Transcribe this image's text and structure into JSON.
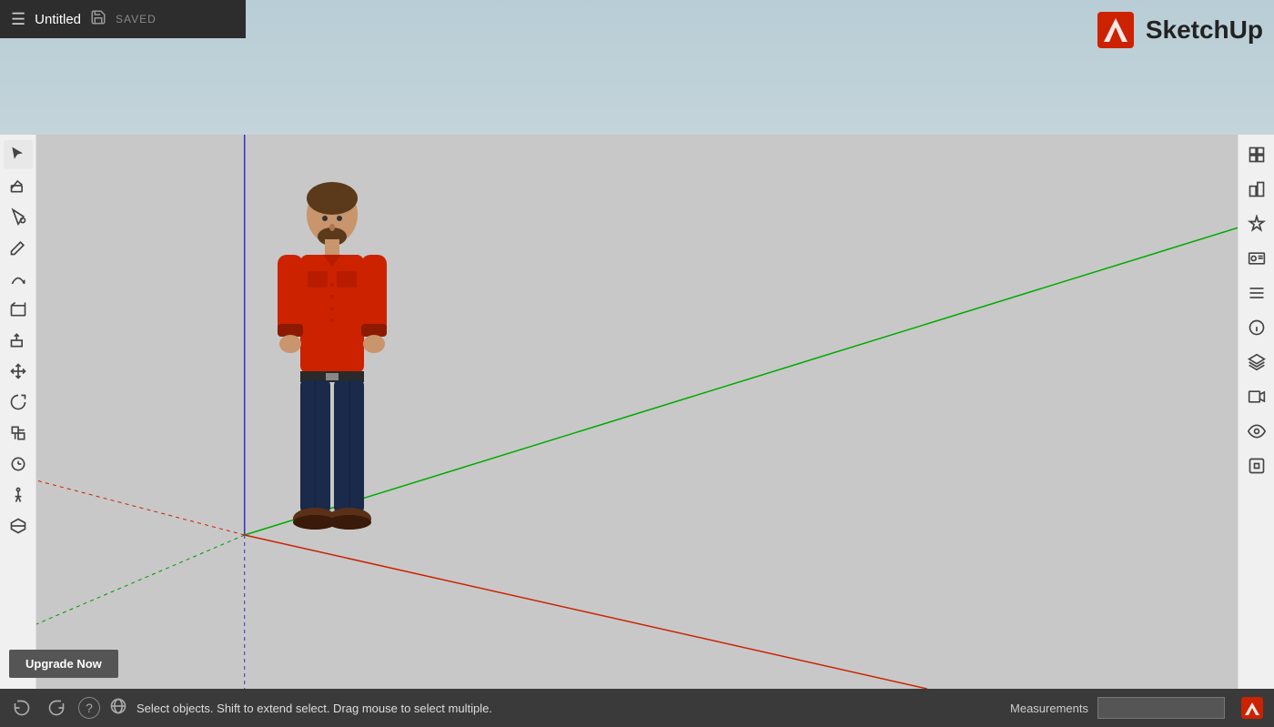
{
  "titlebar": {
    "title": "Untitled",
    "saved_label": "SAVED"
  },
  "logo": {
    "text": "SketchUp"
  },
  "bottom_bar": {
    "status_text": "Select objects. Shift to extend select. Drag mouse to select multiple.",
    "measurements_label": "Measurements",
    "measurements_value": ""
  },
  "upgrade_button": {
    "label": "Upgrade Now"
  },
  "left_tools": [
    {
      "name": "select",
      "icon": "cursor"
    },
    {
      "name": "eraser",
      "icon": "eraser"
    },
    {
      "name": "paint-bucket",
      "icon": "paint"
    },
    {
      "name": "pencil",
      "icon": "pencil"
    },
    {
      "name": "arc",
      "icon": "arc"
    },
    {
      "name": "shape",
      "icon": "shape"
    },
    {
      "name": "push-pull",
      "icon": "pushpull"
    },
    {
      "name": "move",
      "icon": "move"
    },
    {
      "name": "rotate",
      "icon": "rotate"
    },
    {
      "name": "scale",
      "icon": "scale"
    },
    {
      "name": "tape-measure",
      "icon": "tape"
    },
    {
      "name": "walk",
      "icon": "walk"
    },
    {
      "name": "section-plane",
      "icon": "section"
    }
  ],
  "right_tools": [
    {
      "name": "materials",
      "icon": "materials"
    },
    {
      "name": "components",
      "icon": "components"
    },
    {
      "name": "styles",
      "icon": "styles"
    },
    {
      "name": "scenes",
      "icon": "scenes"
    },
    {
      "name": "outliner",
      "icon": "outliner"
    },
    {
      "name": "entity-info",
      "icon": "entity"
    },
    {
      "name": "layers",
      "icon": "layers"
    },
    {
      "name": "video",
      "icon": "video"
    },
    {
      "name": "eye",
      "icon": "eye"
    },
    {
      "name": "extension",
      "icon": "extension"
    }
  ],
  "colors": {
    "axis_red": "#cc2200",
    "axis_green": "#00aa00",
    "axis_blue": "#3333cc",
    "axis_red_dotted": "#cc2200",
    "axis_green_dotted": "#009900",
    "background_top": "#b8ccd4",
    "background_canvas": "#c5c5c5"
  }
}
